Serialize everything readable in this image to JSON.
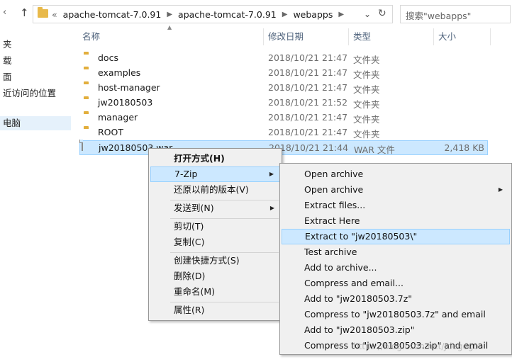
{
  "toolbar": {
    "back_icon": "back-arrow-icon",
    "up_icon": "up-arrow-icon",
    "overflow": "«",
    "breadcrumbs": [
      "apache-tomcat-7.0.91",
      "apache-tomcat-7.0.91",
      "webapps"
    ],
    "search_placeholder": "搜索\"webapps\""
  },
  "sidebar": {
    "items": [
      {
        "label": "夹"
      },
      {
        "label": "载"
      },
      {
        "label": "面"
      },
      {
        "label": "近访问的位置"
      },
      {
        "label": "电脑"
      }
    ]
  },
  "columns": {
    "name": "名称",
    "date": "修改日期",
    "type": "类型",
    "size": "大小"
  },
  "files": [
    {
      "name": "docs",
      "date": "2018/10/21 21:47",
      "type": "文件夹",
      "size": "",
      "icon": "folder-icon"
    },
    {
      "name": "examples",
      "date": "2018/10/21 21:47",
      "type": "文件夹",
      "size": "",
      "icon": "folder-icon"
    },
    {
      "name": "host-manager",
      "date": "2018/10/21 21:47",
      "type": "文件夹",
      "size": "",
      "icon": "folder-icon"
    },
    {
      "name": "jw20180503",
      "date": "2018/10/21 21:52",
      "type": "文件夹",
      "size": "",
      "icon": "folder-icon"
    },
    {
      "name": "manager",
      "date": "2018/10/21 21:47",
      "type": "文件夹",
      "size": "",
      "icon": "folder-icon"
    },
    {
      "name": "ROOT",
      "date": "2018/10/21 21:47",
      "type": "文件夹",
      "size": "",
      "icon": "folder-icon"
    },
    {
      "name": "jw20180503.war",
      "date": "2018/10/21 21:44",
      "type": "WAR 文件",
      "size": "2,418 KB",
      "icon": "file-icon"
    }
  ],
  "context_menu": {
    "items": [
      {
        "label": "打开方式(H)"
      },
      {
        "label": "7-Zip"
      },
      {
        "label": "还原以前的版本(V)"
      },
      {
        "label": "发送到(N)"
      },
      {
        "label": "剪切(T)"
      },
      {
        "label": "复制(C)"
      },
      {
        "label": "创建快捷方式(S)"
      },
      {
        "label": "删除(D)"
      },
      {
        "label": "重命名(M)"
      },
      {
        "label": "属性(R)"
      }
    ]
  },
  "zip_menu": {
    "items": [
      {
        "label": "Open archive"
      },
      {
        "label": "Open archive"
      },
      {
        "label": "Extract files..."
      },
      {
        "label": "Extract Here"
      },
      {
        "label": "Extract to \"jw20180503\\\""
      },
      {
        "label": "Test archive"
      },
      {
        "label": "Add to archive..."
      },
      {
        "label": "Compress and email..."
      },
      {
        "label": "Add to \"jw20180503.7z\""
      },
      {
        "label": "Compress to \"jw20180503.7z\" and email"
      },
      {
        "label": "Add to \"jw20180503.zip\""
      },
      {
        "label": "Compress to \"jw20180503.zip\" and email"
      }
    ]
  },
  "watermark": "https://blog.csdn.net/Jdogogo"
}
